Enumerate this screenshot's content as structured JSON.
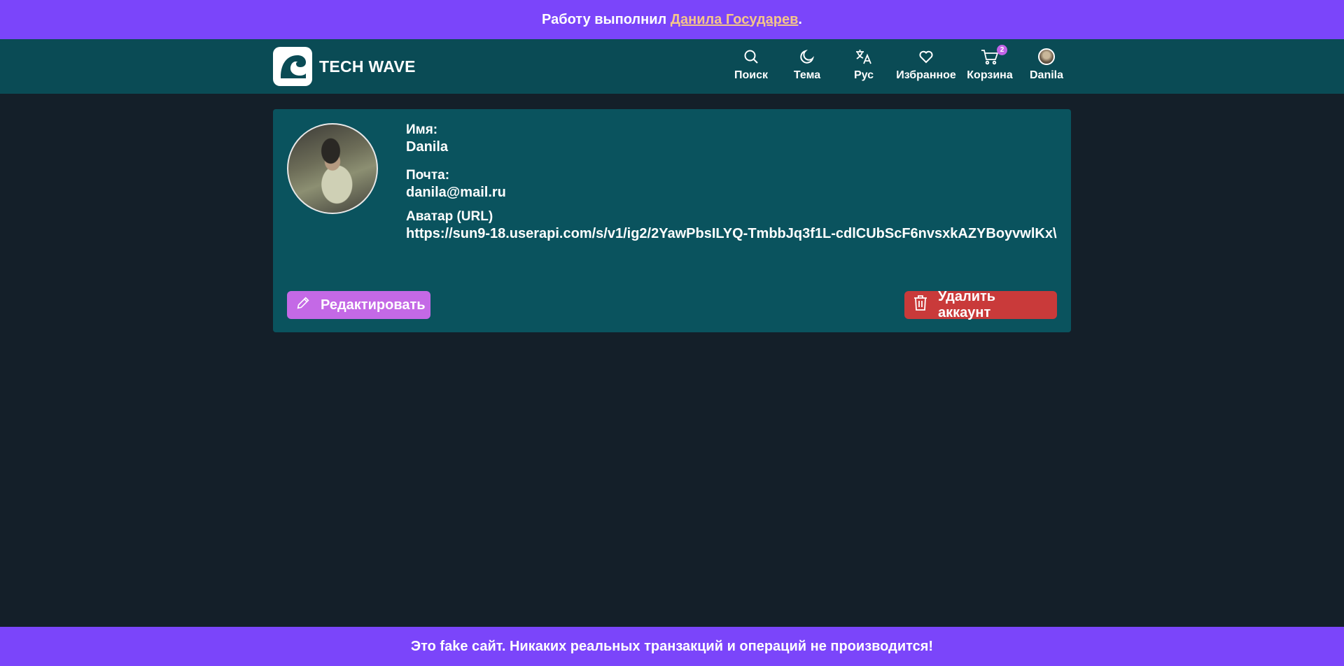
{
  "top_banner": {
    "prefix": "Работу выполнил ",
    "author_link": "Данила Государев",
    "suffix": "."
  },
  "header": {
    "brand": "TECH WAVE",
    "nav": [
      {
        "label": "Поиск",
        "icon": "search-icon"
      },
      {
        "label": "Тема",
        "icon": "moon-icon"
      },
      {
        "label": "Рус",
        "icon": "translate-icon"
      },
      {
        "label": "Избранное",
        "icon": "heart-icon"
      },
      {
        "label": "Корзина",
        "icon": "cart-icon",
        "badge": "2"
      },
      {
        "label": "Danila",
        "icon": "user-avatar"
      }
    ]
  },
  "profile": {
    "name_label": "Имя:",
    "name_value": "Danila",
    "email_label": "Почта:",
    "email_value": "danila@mail.ru",
    "avatar_label": "Аватар (URL)",
    "avatar_value": "https://sun9-18.userapi.com/s/v1/ig2/2YawPbsILYQ-TmbbJq3f1L-cdlCUbScF6nvsxkAZYBoyvwlKx\\",
    "edit_button": "Редактировать",
    "delete_button": "Удалить аккаунт"
  },
  "footer": {
    "text": "Это fake сайт. Никаких реальных транзакций и операций не производится!"
  },
  "colors": {
    "banner_bg": "#7b45fa",
    "header_bg": "#0a4b55",
    "page_bg": "#141f29",
    "card_bg": "#0a535e",
    "link": "#f5c58a",
    "edit_btn": "#c469e6",
    "delete_btn": "#c93a3a",
    "badge": "#c264e8"
  }
}
